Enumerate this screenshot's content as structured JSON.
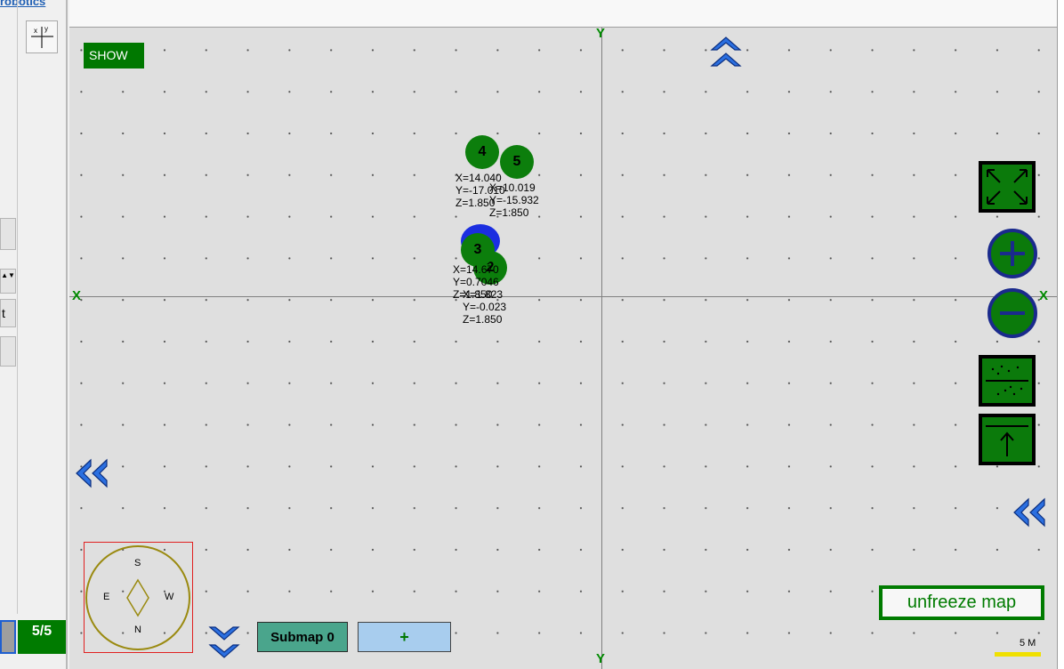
{
  "left_panel": {
    "title_fragment": "robotics",
    "stepper_symbols": "▲▼",
    "side_letter": "t",
    "page_indicator": "5/5"
  },
  "map": {
    "show_button": "SHOW",
    "axis_labels": {
      "y_top": "Y",
      "y_bottom": "Y",
      "x_left": "X",
      "x_right": "X"
    },
    "markers": [
      {
        "id": "4",
        "coords": "X=14.040\nY=-17.010\nZ=1.850"
      },
      {
        "id": "5",
        "coords": "X=10.019\nY=-15.932\nZ=1:850"
      },
      {
        "id": "3",
        "coords": "X=14.670\nY=0.7046\nZ=1.850"
      },
      {
        "id": "2",
        "coords": "X=1.823\nY=-0.023\nZ=1.850"
      }
    ],
    "unfreeze_label": "unfreeze map",
    "scale_label": "5 M",
    "compass": {
      "north": "N",
      "south": "S",
      "east": "E",
      "west": "W"
    },
    "submap_label": "Submap 0",
    "add_submap_label": "+"
  },
  "colors": {
    "map_background": "#dfdfdf",
    "marker_green": "#0c7e0c",
    "accent_green": "#007b00",
    "nav_blue": "#1f5fd0"
  },
  "icons": [
    "axes-toggle-icon",
    "scroll-up-icon",
    "scroll-left-icon",
    "scroll-down-icon",
    "fit-view-icon",
    "zoom-in-icon",
    "zoom-out-icon",
    "point-cloud-icon",
    "up-arrow-icon",
    "compass-icon"
  ]
}
